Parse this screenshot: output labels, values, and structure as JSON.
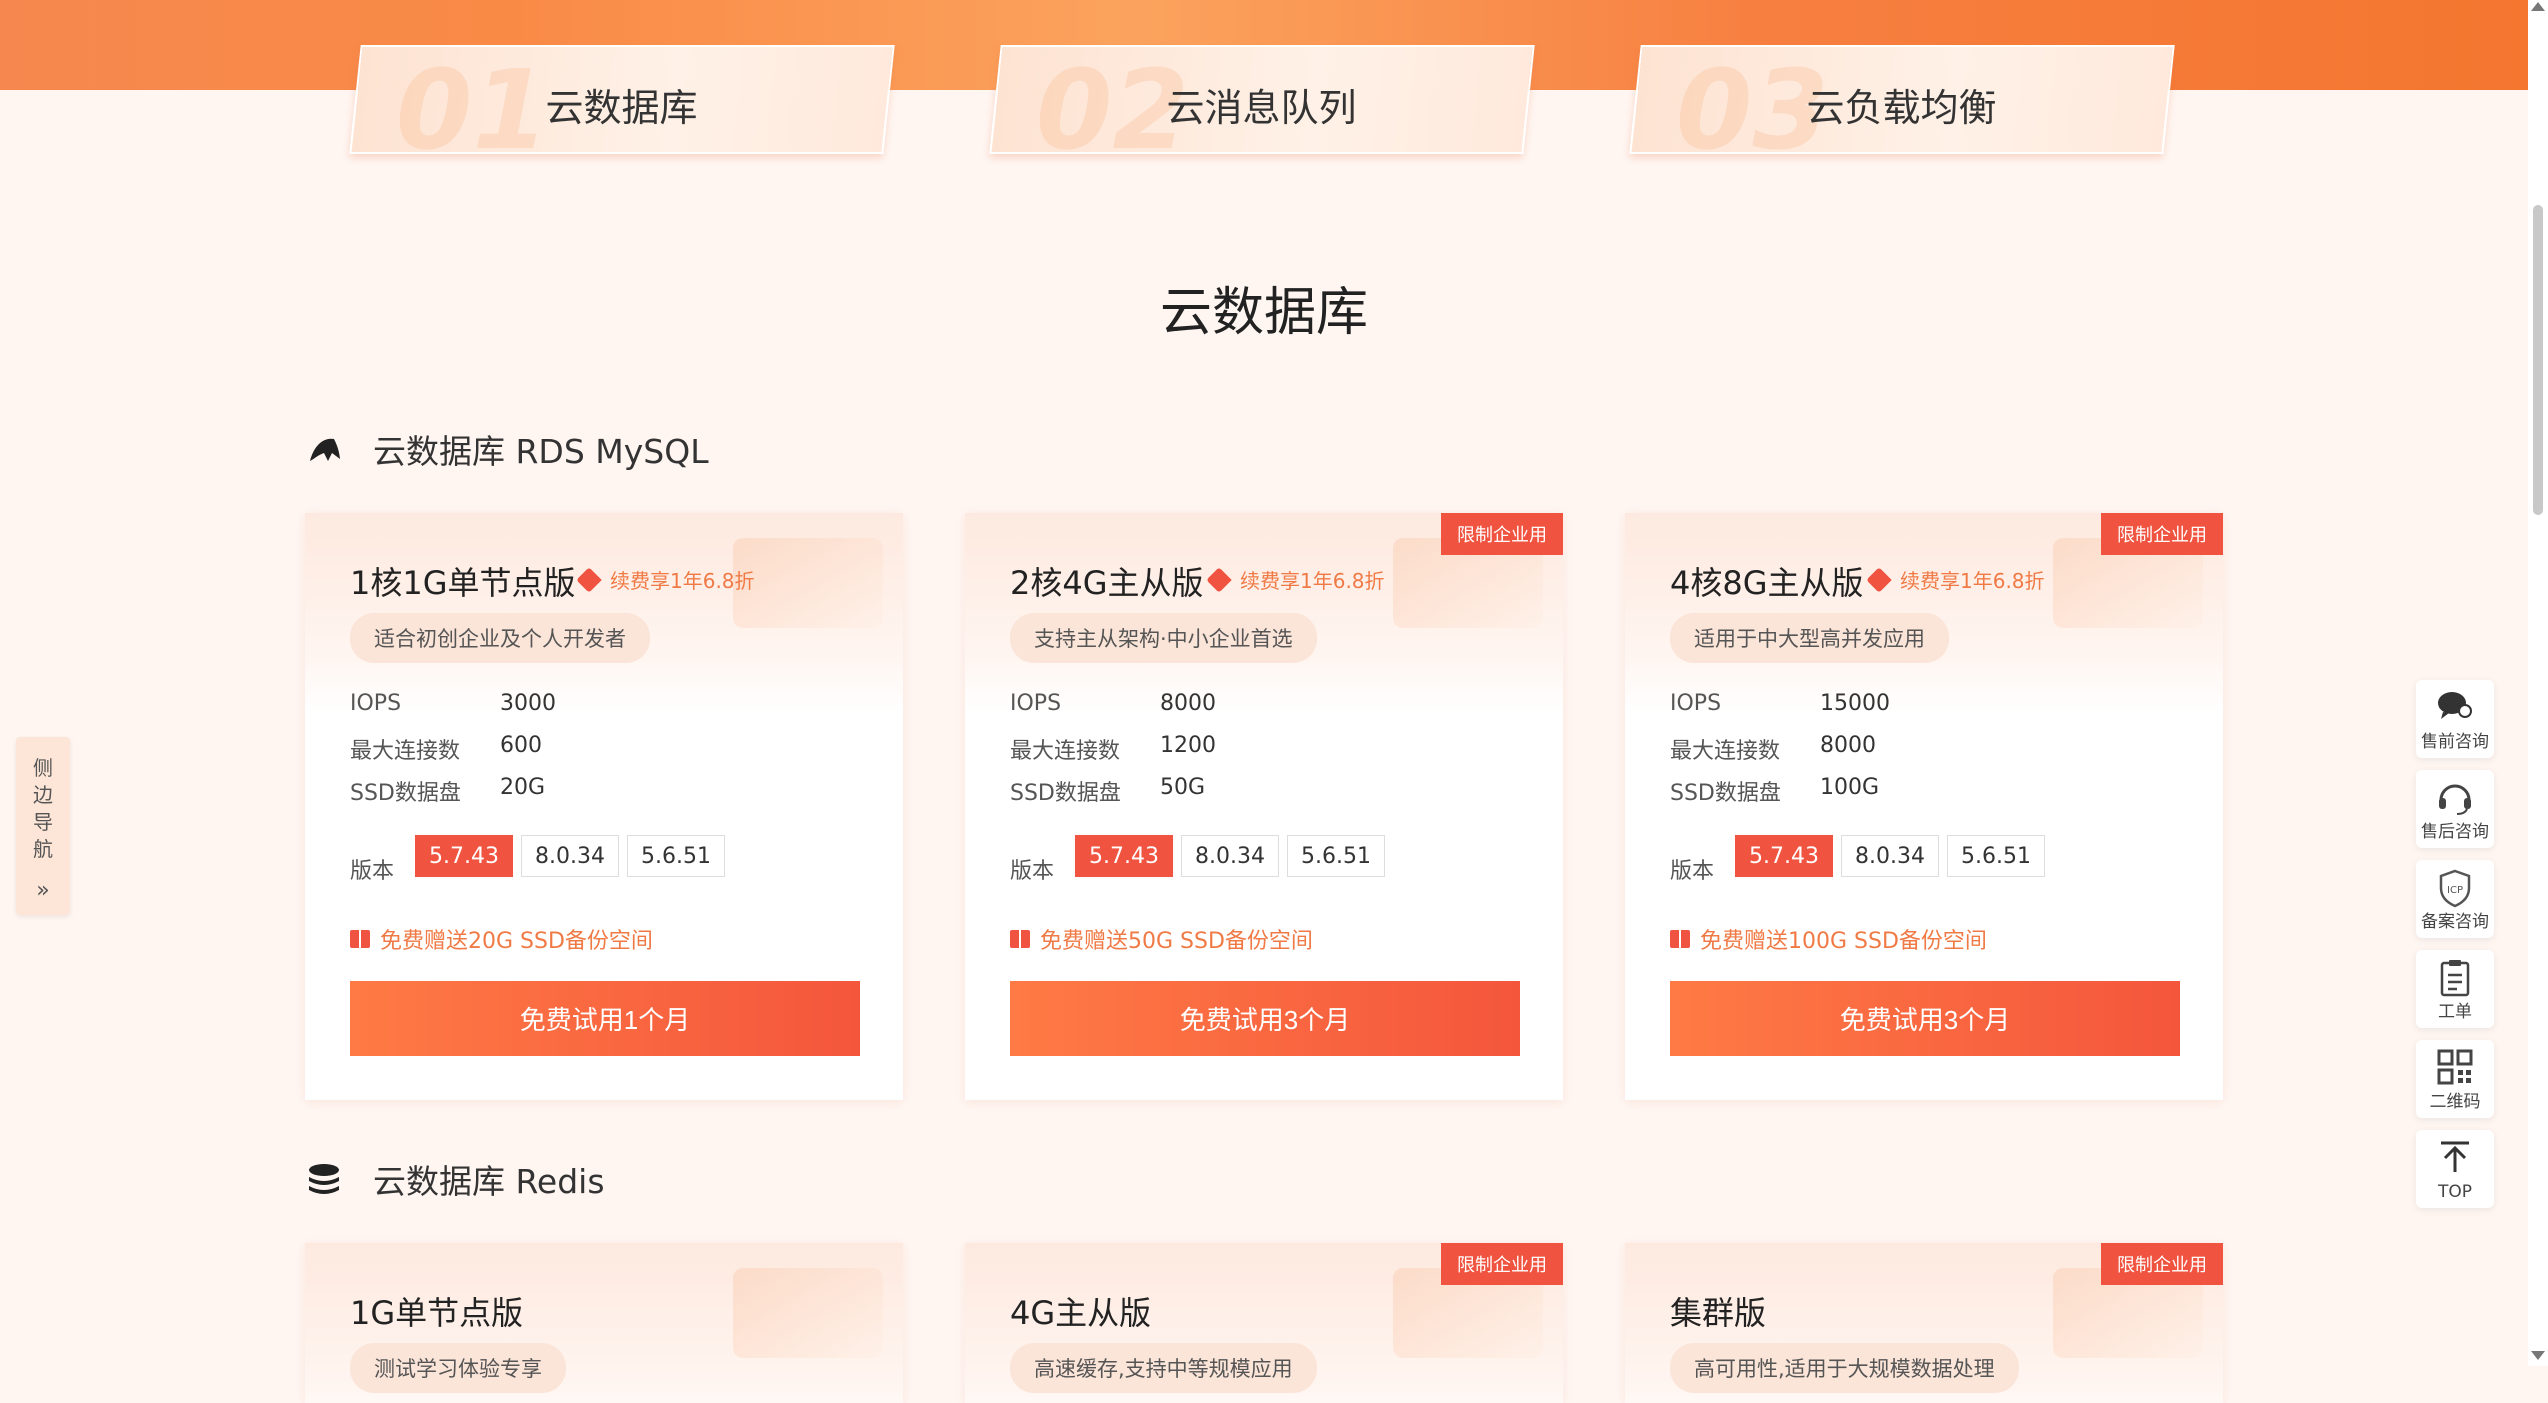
{
  "tabs": [
    {
      "num": "01",
      "label": "云数据库"
    },
    {
      "num": "02",
      "label": "云消息队列"
    },
    {
      "num": "03",
      "label": "云负载均衡"
    }
  ],
  "section_title": "云数据库",
  "mysql": {
    "title": "云数据库 RDS MySQL",
    "cards": [
      {
        "name": "1核1G单节点版",
        "promo": "续费享1年6.8折",
        "desc": "适合初创企业及个人开发者",
        "corner": "",
        "specs": [
          {
            "k": "IOPS",
            "v": "3000"
          },
          {
            "k": "最大连接数",
            "v": "600"
          },
          {
            "k": "SSD数据盘",
            "v": "20G"
          }
        ],
        "version_label": "版本",
        "versions": [
          "5.7.43",
          "8.0.34",
          "5.6.51"
        ],
        "active_version": "5.7.43",
        "gift": "免费赠送20G SSD备份空间",
        "cta": "免费试用1个月"
      },
      {
        "name": "2核4G主从版",
        "promo": "续费享1年6.8折",
        "desc": "支持主从架构·中小企业首选",
        "corner": "限制企业用",
        "specs": [
          {
            "k": "IOPS",
            "v": "8000"
          },
          {
            "k": "最大连接数",
            "v": "1200"
          },
          {
            "k": "SSD数据盘",
            "v": "50G"
          }
        ],
        "version_label": "版本",
        "versions": [
          "5.7.43",
          "8.0.34",
          "5.6.51"
        ],
        "active_version": "5.7.43",
        "gift": "免费赠送50G SSD备份空间",
        "cta": "免费试用3个月"
      },
      {
        "name": "4核8G主从版",
        "promo": "续费享1年6.8折",
        "desc": "适用于中大型高并发应用",
        "corner": "限制企业用",
        "specs": [
          {
            "k": "IOPS",
            "v": "15000"
          },
          {
            "k": "最大连接数",
            "v": "8000"
          },
          {
            "k": "SSD数据盘",
            "v": "100G"
          }
        ],
        "version_label": "版本",
        "versions": [
          "5.7.43",
          "8.0.34",
          "5.6.51"
        ],
        "active_version": "5.7.43",
        "gift": "免费赠送100G SSD备份空间",
        "cta": "免费试用3个月"
      }
    ]
  },
  "redis": {
    "title": "云数据库 Redis",
    "cards": [
      {
        "name": "1G单节点版",
        "desc": "测试学习体验专享",
        "corner": ""
      },
      {
        "name": "4G主从版",
        "desc": "高速缓存,支持中等规模应用",
        "corner": "限制企业用"
      },
      {
        "name": "集群版",
        "desc": "高可用性,适用于大规模数据处理",
        "corner": "限制企业用"
      }
    ]
  },
  "side_nav": {
    "label": "侧边导航",
    "chevron": "»"
  },
  "float_tools": [
    {
      "icon": "chat-icon",
      "label": "售前咨询"
    },
    {
      "icon": "headset-icon",
      "label": "售后咨询"
    },
    {
      "icon": "icp-shield-icon",
      "label": "备案咨询"
    },
    {
      "icon": "clipboard-icon",
      "label": "工单"
    },
    {
      "icon": "qrcode-icon",
      "label": "二维码"
    },
    {
      "icon": "arrow-up-icon",
      "label": "TOP"
    }
  ],
  "icp_text": "ICP",
  "colors": {
    "accent": "#f0533f",
    "promo": "#f07a45",
    "page_bg": "#fff6f2"
  }
}
